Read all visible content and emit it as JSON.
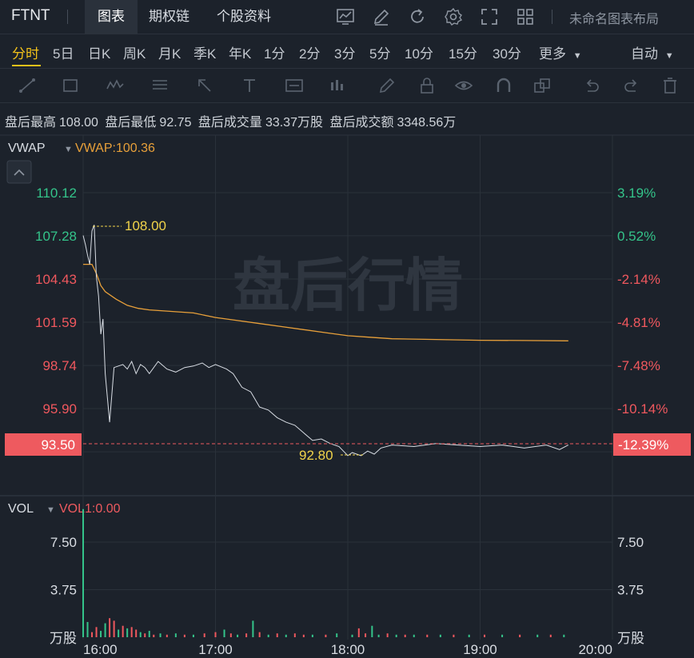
{
  "header": {
    "ticker": "FTNT",
    "tabs": [
      {
        "label": "图表",
        "active": true
      },
      {
        "label": "期权链",
        "active": false
      },
      {
        "label": "个股资料",
        "active": false
      }
    ],
    "layout_name": "未命名图表布局",
    "icons": [
      "chart-settings-icon",
      "pencil-icon",
      "refresh-icon",
      "gear-icon",
      "fullscreen-icon",
      "grid-layout-icon"
    ]
  },
  "periods": {
    "items": [
      "分时",
      "5日",
      "日K",
      "周K",
      "月K",
      "季K",
      "年K",
      "1分",
      "2分",
      "3分",
      "5分",
      "10分",
      "15分",
      "30分",
      "更多"
    ],
    "active": "分时",
    "more_caret": "▼",
    "auto_label": "自动",
    "auto_caret": "▼"
  },
  "toolbar": {
    "tools": [
      "trend-line-icon",
      "rectangle-icon",
      "pattern-icon",
      "fib-icon",
      "arrow-icon",
      "text-icon",
      "label-icon",
      "measure-icon",
      "brush-icon",
      "lock-icon",
      "eye-icon",
      "magnet-icon",
      "layers-icon",
      "undo-icon",
      "redo-icon",
      "trash-icon"
    ]
  },
  "info": {
    "high_label": "盘后最高",
    "high": "108.00",
    "low_label": "盘后最低",
    "low": "92.75",
    "vol_label": "盘后成交量",
    "vol": "33.37万股",
    "amt_label": "盘后成交额",
    "amt": "3348.56万"
  },
  "colors": {
    "up": "#34c48a",
    "down": "#f0585e",
    "price_line": "#d8dde4",
    "vwap_line": "#e8a03a",
    "annotation": "#f0d34a",
    "last_price_bg": "#ee5a5f"
  },
  "chart_data": {
    "type": "line",
    "indicator_label": "VWAP",
    "indicator_value": "VWAP:100.36",
    "watermark": "盘后行情",
    "price_axis_left": [
      "110.12",
      "107.28",
      "104.43",
      "101.59",
      "98.74",
      "95.90"
    ],
    "price_axis_right": [
      "3.19%",
      "0.52%",
      "-2.14%",
      "-4.81%",
      "-7.48%",
      "-10.14%"
    ],
    "last_price": "93.50",
    "last_pct": "-12.39%",
    "high_annotation": "108.00",
    "low_annotation": "92.80",
    "time_labels": [
      "16:00",
      "17:00",
      "18:00",
      "19:00",
      "20:00"
    ],
    "price_series": [
      [
        "16:00",
        107.3
      ],
      [
        "16:01",
        106.7
      ],
      [
        "16:02",
        106.0
      ],
      [
        "16:03",
        105.4
      ],
      [
        "16:04",
        107.6
      ],
      [
        "16:05",
        108.0
      ],
      [
        "16:06",
        104.6
      ],
      [
        "16:07",
        103.3
      ],
      [
        "16:08",
        100.8
      ],
      [
        "16:09",
        101.8
      ],
      [
        "16:10",
        98.2
      ],
      [
        "16:12",
        95.0
      ],
      [
        "16:14",
        98.6
      ],
      [
        "16:18",
        98.8
      ],
      [
        "16:20",
        98.5
      ],
      [
        "16:22",
        99.0
      ],
      [
        "16:24",
        98.2
      ],
      [
        "16:26",
        98.8
      ],
      [
        "16:28",
        98.6
      ],
      [
        "16:30",
        98.2
      ],
      [
        "16:34",
        99.0
      ],
      [
        "16:38",
        98.5
      ],
      [
        "16:42",
        98.3
      ],
      [
        "16:46",
        98.6
      ],
      [
        "16:50",
        98.7
      ],
      [
        "16:54",
        98.9
      ],
      [
        "16:57",
        98.6
      ],
      [
        "17:00",
        98.8
      ],
      [
        "17:05",
        98.5
      ],
      [
        "17:08",
        98.2
      ],
      [
        "17:12",
        97.3
      ],
      [
        "17:16",
        97.0
      ],
      [
        "17:20",
        96.0
      ],
      [
        "17:24",
        95.8
      ],
      [
        "17:28",
        95.3
      ],
      [
        "17:32",
        95.0
      ],
      [
        "17:36",
        94.8
      ],
      [
        "17:40",
        94.3
      ],
      [
        "17:44",
        93.8
      ],
      [
        "17:48",
        93.9
      ],
      [
        "17:52",
        93.6
      ],
      [
        "17:56",
        93.4
      ],
      [
        "18:00",
        92.8
      ],
      [
        "18:02",
        93.0
      ],
      [
        "18:06",
        92.8
      ],
      [
        "18:09",
        93.1
      ],
      [
        "18:12",
        92.9
      ],
      [
        "18:15",
        93.3
      ],
      [
        "18:20",
        93.5
      ],
      [
        "18:30",
        93.4
      ],
      [
        "18:40",
        93.6
      ],
      [
        "18:50",
        93.5
      ],
      [
        "19:00",
        93.4
      ],
      [
        "19:10",
        93.5
      ],
      [
        "19:20",
        93.3
      ],
      [
        "19:30",
        93.5
      ],
      [
        "19:36",
        93.2
      ],
      [
        "19:40",
        93.5
      ]
    ],
    "vwap_series": [
      [
        "16:00",
        105.4
      ],
      [
        "16:04",
        105.4
      ],
      [
        "16:06",
        104.8
      ],
      [
        "16:08",
        104.0
      ],
      [
        "16:10",
        103.6
      ],
      [
        "16:15",
        103.1
      ],
      [
        "16:20",
        102.7
      ],
      [
        "16:25",
        102.5
      ],
      [
        "16:30",
        102.4
      ],
      [
        "16:40",
        102.3
      ],
      [
        "16:50",
        102.2
      ],
      [
        "17:00",
        101.9
      ],
      [
        "17:10",
        101.7
      ],
      [
        "17:20",
        101.5
      ],
      [
        "17:30",
        101.3
      ],
      [
        "17:40",
        101.1
      ],
      [
        "17:50",
        100.9
      ],
      [
        "18:00",
        100.7
      ],
      [
        "18:10",
        100.6
      ],
      [
        "18:20",
        100.5
      ],
      [
        "18:40",
        100.45
      ],
      [
        "19:00",
        100.4
      ],
      [
        "19:20",
        100.38
      ],
      [
        "19:40",
        100.36
      ]
    ]
  },
  "volume": {
    "label": "VOL",
    "caret": "▼",
    "value": "VOL1:0.00",
    "axis_left": [
      "7.50",
      "3.75",
      "万股"
    ],
    "axis_right": [
      "7.50",
      "3.75",
      "万股"
    ],
    "bars": [
      [
        "16:00",
        10.1,
        "up"
      ],
      [
        "16:02",
        1.2,
        "up"
      ],
      [
        "16:04",
        0.4,
        "down"
      ],
      [
        "16:06",
        0.8,
        "down"
      ],
      [
        "16:08",
        0.5,
        "up"
      ],
      [
        "16:10",
        1.1,
        "up"
      ],
      [
        "16:12",
        1.5,
        "down"
      ],
      [
        "16:14",
        1.3,
        "down"
      ],
      [
        "16:16",
        0.6,
        "up"
      ],
      [
        "16:18",
        0.9,
        "down"
      ],
      [
        "16:20",
        0.7,
        "up"
      ],
      [
        "16:22",
        0.8,
        "down"
      ],
      [
        "16:24",
        0.6,
        "down"
      ],
      [
        "16:26",
        0.4,
        "up"
      ],
      [
        "16:28",
        0.3,
        "down"
      ],
      [
        "16:30",
        0.5,
        "up"
      ],
      [
        "16:32",
        0.2,
        "down"
      ],
      [
        "16:35",
        0.3,
        "up"
      ],
      [
        "16:38",
        0.2,
        "down"
      ],
      [
        "16:42",
        0.3,
        "up"
      ],
      [
        "16:46",
        0.2,
        "down"
      ],
      [
        "16:50",
        0.2,
        "up"
      ],
      [
        "16:55",
        0.3,
        "down"
      ],
      [
        "17:00",
        0.4,
        "down"
      ],
      [
        "17:04",
        0.6,
        "up"
      ],
      [
        "17:07",
        0.3,
        "down"
      ],
      [
        "17:10",
        0.2,
        "up"
      ],
      [
        "17:14",
        0.3,
        "down"
      ],
      [
        "17:17",
        1.3,
        "up"
      ],
      [
        "17:20",
        0.4,
        "down"
      ],
      [
        "17:24",
        0.2,
        "up"
      ],
      [
        "17:28",
        0.3,
        "down"
      ],
      [
        "17:32",
        0.2,
        "up"
      ],
      [
        "17:36",
        0.3,
        "down"
      ],
      [
        "17:40",
        0.2,
        "down"
      ],
      [
        "17:44",
        0.2,
        "up"
      ],
      [
        "17:50",
        0.2,
        "down"
      ],
      [
        "17:55",
        0.3,
        "up"
      ],
      [
        "18:02",
        0.2,
        "up"
      ],
      [
        "18:05",
        0.7,
        "down"
      ],
      [
        "18:08",
        0.3,
        "down"
      ],
      [
        "18:11",
        0.9,
        "up"
      ],
      [
        "18:14",
        0.2,
        "up"
      ],
      [
        "18:18",
        0.3,
        "down"
      ],
      [
        "18:22",
        0.2,
        "up"
      ],
      [
        "18:26",
        0.2,
        "down"
      ],
      [
        "18:30",
        0.2,
        "up"
      ],
      [
        "18:36",
        0.2,
        "down"
      ],
      [
        "18:42",
        0.2,
        "up"
      ],
      [
        "18:48",
        0.2,
        "down"
      ],
      [
        "18:55",
        0.2,
        "up"
      ],
      [
        "19:02",
        0.2,
        "down"
      ],
      [
        "19:10",
        0.2,
        "up"
      ],
      [
        "19:18",
        0.2,
        "down"
      ],
      [
        "19:26",
        0.2,
        "up"
      ],
      [
        "19:32",
        0.2,
        "down"
      ],
      [
        "19:38",
        0.2,
        "up"
      ]
    ]
  }
}
